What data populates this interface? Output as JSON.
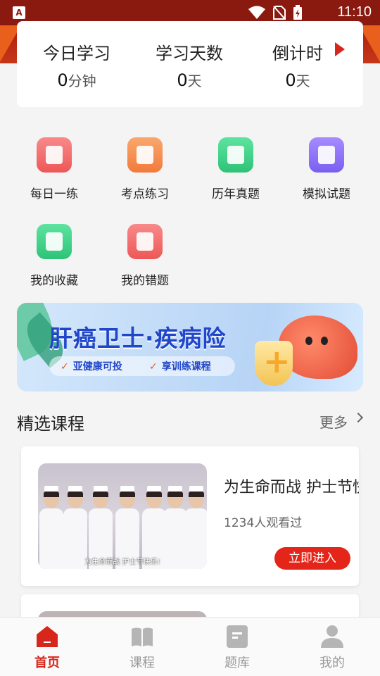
{
  "status_bar": {
    "time": "11:10",
    "app_icon_letter": "A"
  },
  "stats": [
    {
      "label": "今日学习",
      "value": "0",
      "unit": "分钟"
    },
    {
      "label": "学习天数",
      "value": "0",
      "unit": "天"
    },
    {
      "label": "倒计时",
      "value": "0",
      "unit": "天"
    }
  ],
  "quick_menu": [
    {
      "label": "每日一练",
      "color": "#f26b6b",
      "icon": "edit-icon"
    },
    {
      "label": "考点练习",
      "color": "#f5904f",
      "icon": "pen-icon"
    },
    {
      "label": "历年真题",
      "color": "#3fce86",
      "icon": "book-icon"
    },
    {
      "label": "模拟试题",
      "color": "#8b72f0",
      "icon": "papers-icon"
    },
    {
      "label": "我的收藏",
      "color": "#3fce86",
      "icon": "folder-star-icon"
    },
    {
      "label": "我的错题",
      "color": "#f26b6b",
      "icon": "notebook-x-icon"
    }
  ],
  "promo": {
    "title": "肝癌卫士·疾病险",
    "tags": [
      "亚健康可投",
      "享训练课程"
    ]
  },
  "section": {
    "title": "精选课程",
    "more": "更多"
  },
  "courses": [
    {
      "title": "为生命而战 护士节快乐",
      "views": "1234人观看过",
      "cta": "立即进入",
      "thumb_caption": "为生命而战 护士节快乐!"
    }
  ],
  "tabs": [
    {
      "label": "首页",
      "icon": "home-icon",
      "active": true
    },
    {
      "label": "课程",
      "icon": "open-book-icon",
      "active": false
    },
    {
      "label": "题库",
      "icon": "document-icon",
      "active": false
    },
    {
      "label": "我的",
      "icon": "user-icon",
      "active": false
    }
  ],
  "colors": {
    "primary": "#d7261c",
    "header_red": "#b5210f",
    "header_orange": "#e8601c"
  }
}
